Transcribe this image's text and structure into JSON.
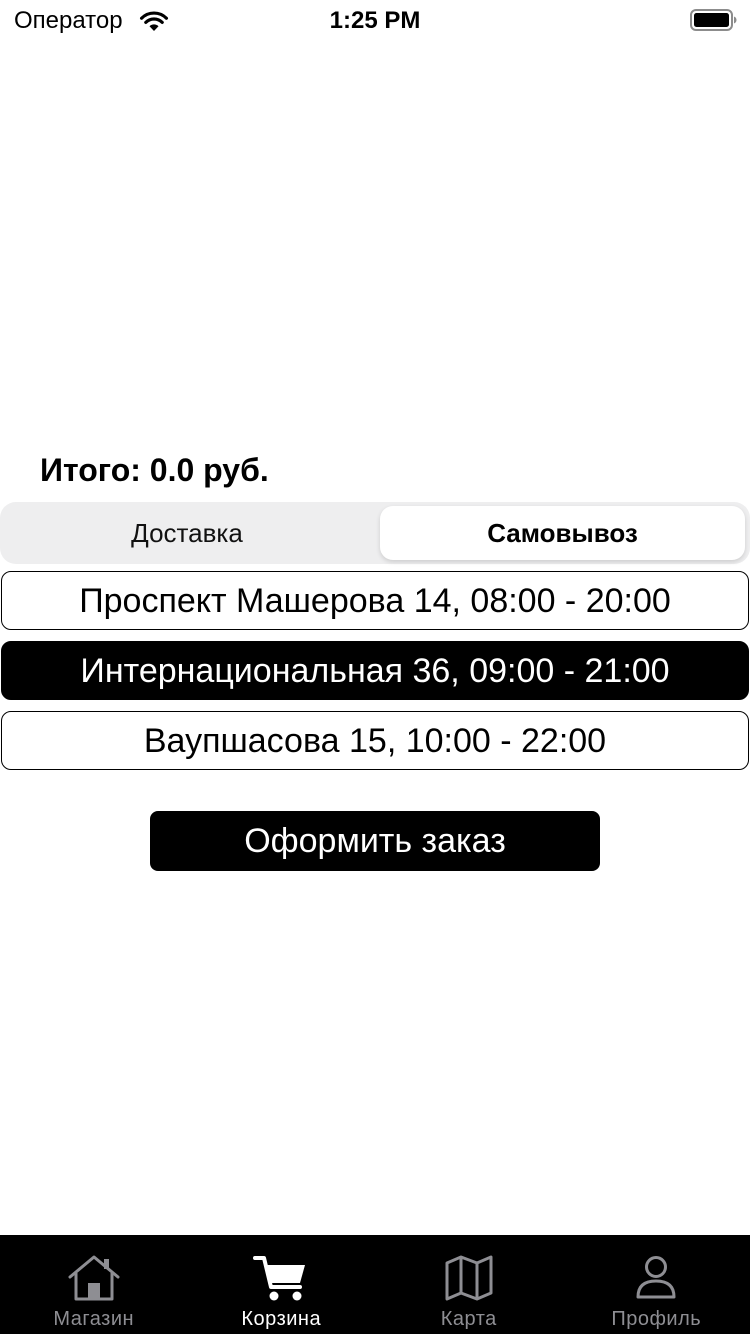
{
  "status_bar": {
    "carrier": "Оператор",
    "time": "1:25 PM",
    "wifi_icon": "wifi-icon",
    "battery_icon": "battery-icon"
  },
  "cart": {
    "total": "Итого: 0.0 руб."
  },
  "delivery_mode": {
    "options": [
      "Доставка",
      "Самовывоз"
    ],
    "selected": "Самовывоз"
  },
  "pickup_locations": [
    {
      "label": "Проспект Машерова 14, 08:00 - 20:00",
      "selected": false
    },
    {
      "label": "Интернациональная 36, 09:00 - 21:00",
      "selected": true
    },
    {
      "label": "Ваупшасова 15, 10:00 - 22:00",
      "selected": false
    }
  ],
  "checkout_button": "Оформить заказ",
  "tab_bar": {
    "active": "Корзина",
    "tabs": [
      {
        "label": "Магазин",
        "icon": "home-icon"
      },
      {
        "label": "Корзина",
        "icon": "cart-icon"
      },
      {
        "label": "Карта",
        "icon": "map-icon"
      },
      {
        "label": "Профиль",
        "icon": "person-icon"
      }
    ]
  },
  "colors": {
    "background": "#ffffff",
    "accent": "#000000",
    "inactive_tab": "#8e8e93",
    "segment_track": "#eeeeef"
  }
}
